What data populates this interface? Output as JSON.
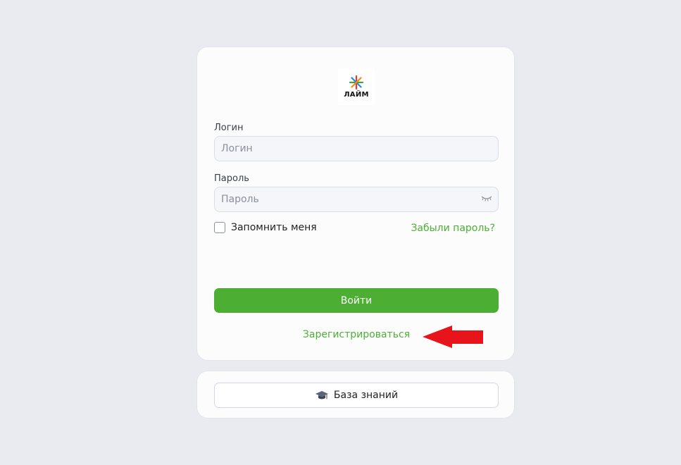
{
  "logo": {
    "text": "ЛАЙМ",
    "icon": "lime-logo-icon"
  },
  "login": {
    "label": "Логин",
    "placeholder": "Логин"
  },
  "password": {
    "label": "Пароль",
    "placeholder": "Пароль",
    "toggle_icon": "eye-closed-icon"
  },
  "remember": {
    "label": "Запомнить меня",
    "checked": false
  },
  "forgot": {
    "label": "Забыли пароль?"
  },
  "submit": {
    "label": "Войти"
  },
  "register": {
    "label": "Зарегистрироваться"
  },
  "knowledge_base": {
    "label": "База знаний",
    "icon": "graduation-cap-icon"
  },
  "colors": {
    "accent": "#4caf33",
    "background": "#e9ebf0",
    "annotation_arrow": "#e8141c"
  }
}
